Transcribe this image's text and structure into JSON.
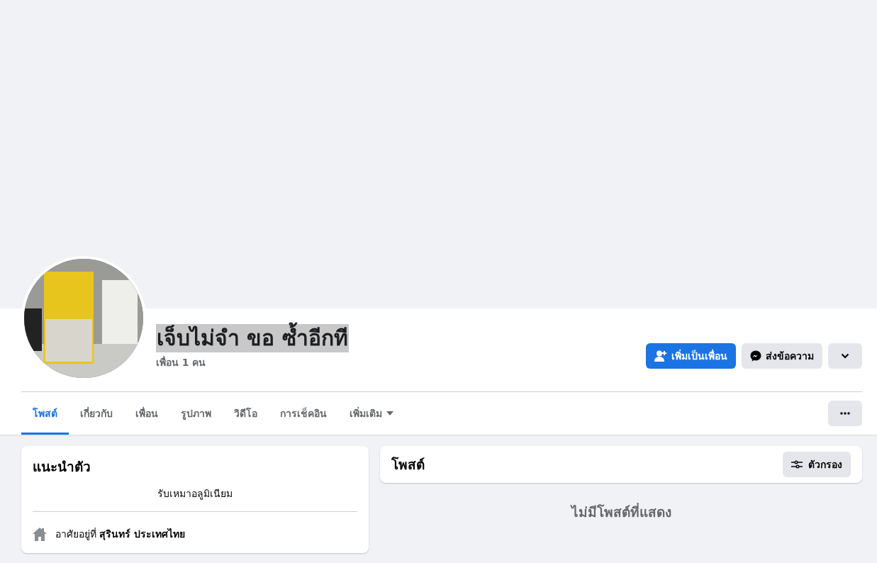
{
  "profile": {
    "name": "เจ็บไม่จำ ขอ ซ้ำอีกที",
    "name_highlighted": true,
    "friends_count": "เพื่อน 1 คน"
  },
  "actions": [
    {
      "kind": "primary",
      "label": "เพิ่มเป็นเพื่อน"
    },
    {
      "kind": "secondary",
      "label": "ส่งข้อความ"
    },
    {
      "kind": "dropdown"
    }
  ],
  "tabs": [
    {
      "label": "โพสต์",
      "selected": true
    },
    {
      "label": "เกี่ยวกับ",
      "selected": false
    },
    {
      "label": "เพื่อน",
      "selected": false
    },
    {
      "label": "รูปภาพ",
      "selected": false
    },
    {
      "label": "วิดีโอ",
      "selected": false
    },
    {
      "label": "การเช็คอิน",
      "selected": false
    },
    {
      "label": "เพิ่มเติม",
      "selected": false,
      "has_menu": true
    }
  ],
  "intro": {
    "title": "แนะนำตัว",
    "bio": "รับเหมาอลูมิเนียม",
    "lives_in": "อาศัยอยู่ที่ **สุรินทร์ ประเทศไทย**"
  },
  "posts": {
    "title": "โพสต์",
    "filter_label": "ตัวกรอง",
    "empty_message": "ไม่มีโพสต์ที่แสดง"
  }
}
